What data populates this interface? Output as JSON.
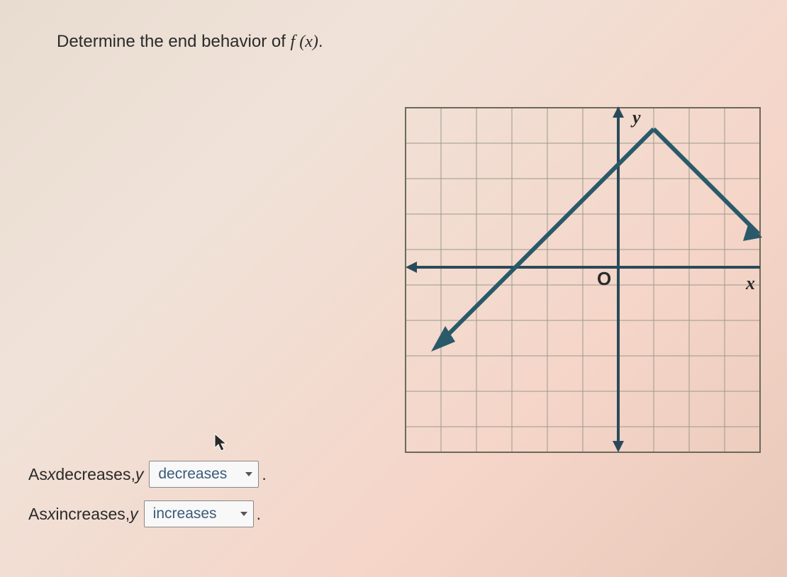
{
  "question": {
    "prefix": "Determine the end behavior of ",
    "fx": "f (x)",
    "suffix": "."
  },
  "answers": {
    "row1": {
      "prefix": "As ",
      "var1": "x",
      "mid": " decreases, ",
      "var2": "y",
      "selected": "decreases"
    },
    "row2": {
      "prefix": "As ",
      "var1": "x",
      "mid": " increases, ",
      "var2": "y",
      "selected": "increases"
    }
  },
  "chart_data": {
    "type": "line",
    "title": "",
    "xlabel": "x",
    "ylabel": "y",
    "origin_label": "O",
    "xlim": [
      -5,
      5
    ],
    "ylim": [
      -5,
      5
    ],
    "grid": true,
    "series": [
      {
        "name": "f(x)",
        "points": [
          {
            "x": -5,
            "y": -2
          },
          {
            "x": -3,
            "y": 0
          },
          {
            "x": 1,
            "y": 4
          },
          {
            "x": 5,
            "y": 0
          }
        ],
        "arrows": {
          "start": true,
          "end": true
        }
      }
    ]
  }
}
